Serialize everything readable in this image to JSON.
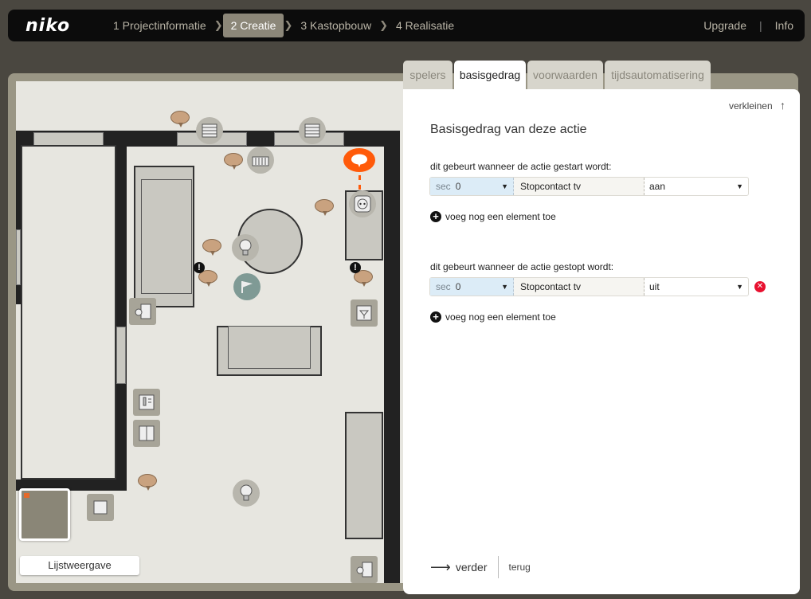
{
  "header": {
    "logo": "niko",
    "steps": [
      {
        "label": "1 Projectinformatie"
      },
      {
        "label": "2 Creatie"
      },
      {
        "label": "3 Kastopbouw"
      },
      {
        "label": "4 Realisatie"
      }
    ],
    "upgrade": "Upgrade",
    "info": "Info"
  },
  "canvas": {
    "list_view_button": "Lijstweergave"
  },
  "tabs": {
    "spelers": "spelers",
    "basisgedrag": "basisgedrag",
    "voorwaarden": "voorwaarden",
    "tijdsautomatisering": "tijdsautomatisering"
  },
  "panel": {
    "collapse": "verkleinen",
    "title": "Basisgedrag van deze actie",
    "start_section": {
      "label": "dit gebeurt wanneer de actie gestart wordt:",
      "unit": "sec",
      "delay": "0",
      "device": "Stopcontact tv",
      "value": "aan",
      "add": "voeg nog een element toe"
    },
    "stop_section": {
      "label": "dit gebeurt wanneer de actie gestopt wordt:",
      "unit": "sec",
      "delay": "0",
      "device": "Stopcontact tv",
      "value": "uit",
      "add": "voeg nog een element toe"
    },
    "next": "verder",
    "back": "terug"
  },
  "colors": {
    "accent": "#ff5a0a",
    "delete": "#e8102f",
    "topbar": "#0c0c0c",
    "active_step": "#8c8779"
  }
}
